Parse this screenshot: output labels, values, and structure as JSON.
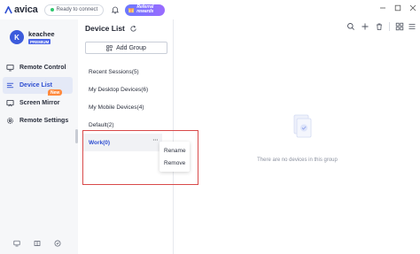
{
  "app": {
    "name": "avica"
  },
  "topbar": {
    "status": "Ready to connect",
    "referral_line1": "Referral",
    "referral_line2": "rewards"
  },
  "profile": {
    "initial": "K",
    "username": "keachee",
    "badge": "PREMIUM"
  },
  "nav": {
    "items": [
      {
        "label": "Remote Control",
        "icon": "monitor-icon"
      },
      {
        "label": "Device List",
        "icon": "list-icon",
        "active": true
      },
      {
        "label": "Screen Mirror",
        "icon": "screen-mirror-icon",
        "badge": "New"
      },
      {
        "label": "Remote Settings",
        "icon": "gear-icon"
      }
    ]
  },
  "device_list": {
    "title": "Device List",
    "add_group_label": "Add Group",
    "groups": [
      {
        "label": "Recent Sessions(5)"
      },
      {
        "label": "My Desktop Devices(6)"
      },
      {
        "label": "My Mobile Devices(4)"
      },
      {
        "label": "Default(2)"
      },
      {
        "label": "Work(0)",
        "selected": true
      }
    ],
    "context_menu": {
      "rename": "Rename",
      "remove": "Remove"
    }
  },
  "main": {
    "empty_message": "There are no devices in this group"
  },
  "colors": {
    "accent": "#2f4fd1",
    "status_ok": "#2fc76e",
    "new_badge": "#ff8a3d",
    "highlight": "#d94a4a"
  }
}
